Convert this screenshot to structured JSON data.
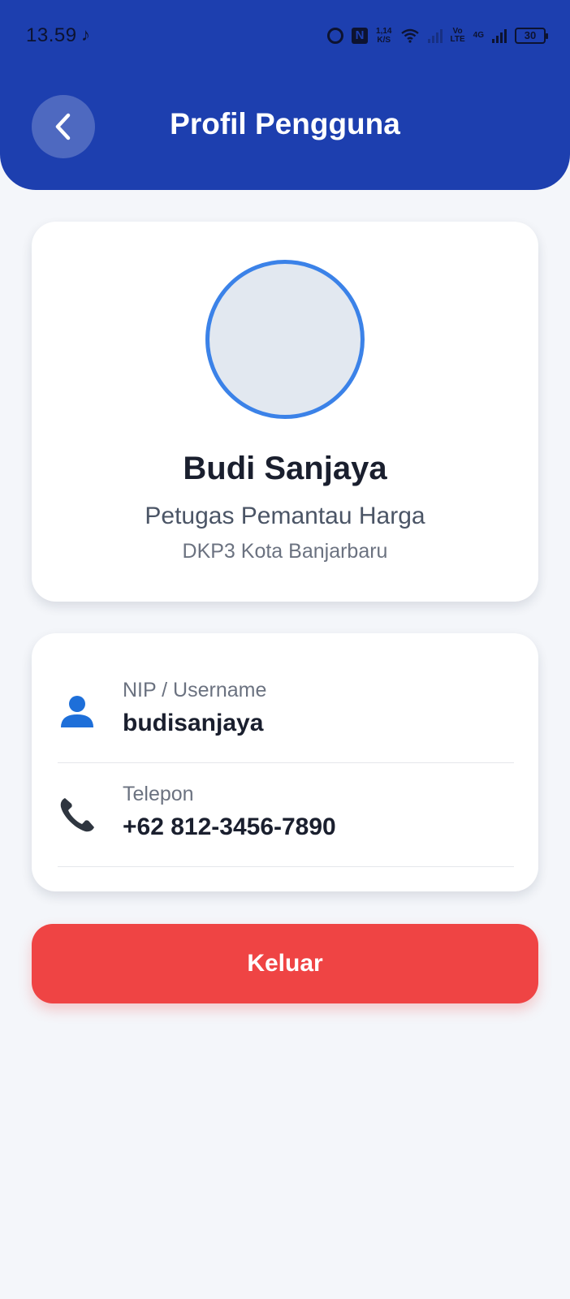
{
  "status_bar": {
    "time": "13.59",
    "network_speed": "1,14",
    "network_speed_unit": "K/S",
    "volte_top": "Vo",
    "volte_bottom": "LTE",
    "network_type": "4G",
    "battery": "30"
  },
  "header": {
    "title": "Profil Pengguna",
    "background_color": "#1d3faf"
  },
  "profile": {
    "name": "Budi Sanjaya",
    "role": "Petugas Pemantau Harga",
    "organization": "DKP3 Kota Banjarbaru",
    "avatar_ring_color": "#3b82e8"
  },
  "info": [
    {
      "icon": "user-icon",
      "label": "NIP / Username",
      "value": "budisanjaya"
    },
    {
      "icon": "phone-icon",
      "label": "Telepon",
      "value": "+62 812-3456-7890"
    }
  ],
  "logout": {
    "label": "Keluar",
    "color": "#ef4444"
  }
}
